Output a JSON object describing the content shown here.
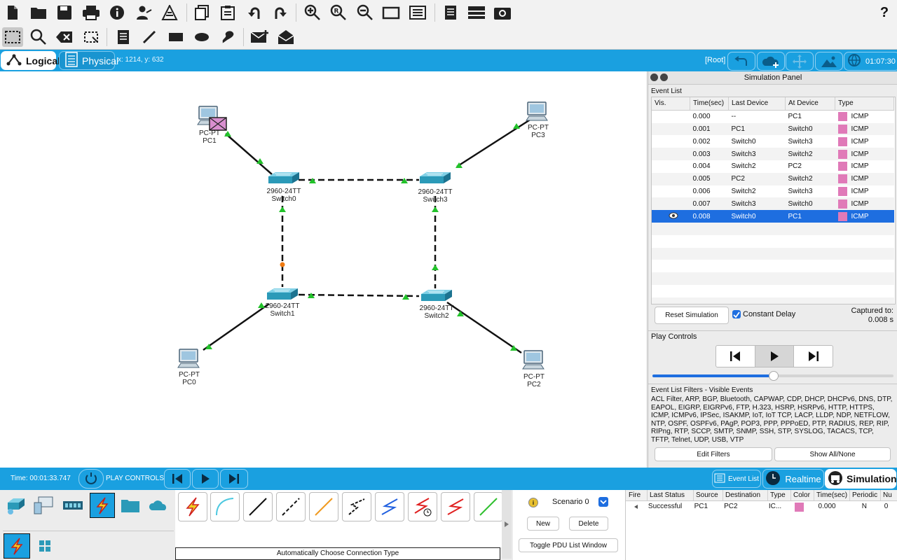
{
  "window": {
    "help": "?"
  },
  "tabs": {
    "logical": "Logical",
    "physical": "Physical",
    "coords": "x: 1214, y: 632"
  },
  "right_controls": {
    "root": "[Root]",
    "clock": "01:07:30"
  },
  "devices": [
    {
      "id": "pc1",
      "type": "PC-PT",
      "name": "PC1"
    },
    {
      "id": "pc3",
      "type": "PC-PT",
      "name": "PC3"
    },
    {
      "id": "pc0",
      "type": "PC-PT",
      "name": "PC0"
    },
    {
      "id": "pc2",
      "type": "PC-PT",
      "name": "PC2"
    },
    {
      "id": "sw0",
      "type": "2960-24TT",
      "name": "Switch0"
    },
    {
      "id": "sw3",
      "type": "2960-24TT",
      "name": "Switch3"
    },
    {
      "id": "sw1",
      "type": "2960-24TT",
      "name": "Switch1"
    },
    {
      "id": "sw2",
      "type": "2960-24TT",
      "name": "Switch2"
    }
  ],
  "sim": {
    "title": "Simulation Panel",
    "event_list_label": "Event List",
    "headers": [
      "Vis.",
      "Time(sec)",
      "Last Device",
      "At Device",
      "Type"
    ],
    "events": [
      {
        "time": "0.000",
        "last": "--",
        "at": "PC1",
        "type": "ICMP"
      },
      {
        "time": "0.001",
        "last": "PC1",
        "at": "Switch0",
        "type": "ICMP"
      },
      {
        "time": "0.002",
        "last": "Switch0",
        "at": "Switch3",
        "type": "ICMP"
      },
      {
        "time": "0.003",
        "last": "Switch3",
        "at": "Switch2",
        "type": "ICMP"
      },
      {
        "time": "0.004",
        "last": "Switch2",
        "at": "PC2",
        "type": "ICMP"
      },
      {
        "time": "0.005",
        "last": "PC2",
        "at": "Switch2",
        "type": "ICMP"
      },
      {
        "time": "0.006",
        "last": "Switch2",
        "at": "Switch3",
        "type": "ICMP"
      },
      {
        "time": "0.007",
        "last": "Switch3",
        "at": "Switch0",
        "type": "ICMP"
      },
      {
        "time": "0.008",
        "last": "Switch0",
        "at": "PC1",
        "type": "ICMP"
      }
    ],
    "event_color": "#e07ab8",
    "reset_label": "Reset Simulation",
    "constant_delay": "Constant Delay",
    "captured_label": "Captured to:",
    "captured_value": "0.008 s",
    "play_controls": "Play Controls",
    "progress": 0.5,
    "filters_title": "Event List Filters - Visible Events",
    "filters_text": "ACL Filter, ARP, BGP, Bluetooth, CAPWAP, CDP, DHCP, DHCPv6, DNS, DTP, EAPOL, EIGRP, EIGRPv6, FTP, H.323, HSRP, HSRPv6, HTTP, HTTPS, ICMP, ICMPv6, IPSec, ISAKMP, IoT, IoT TCP, LACP, LLDP, NDP, NETFLOW, NTP, OSPF, OSPFv6, PAgP, POP3, PPP, PPPoED, PTP, RADIUS, REP, RIP, RIPng, RTP, SCCP, SMTP, SNMP, SSH, STP, SYSLOG, TACACS, TCP, TFTP, Telnet, UDP, USB, VTP",
    "edit_filters": "Edit Filters",
    "show_all": "Show All/None"
  },
  "bottom_bar": {
    "time": "Time: 00:01:33.747",
    "play_controls": "PLAY CONTROLS",
    "event_list": "Event List",
    "realtime": "Realtime",
    "simulation": "Simulation"
  },
  "device_panel": {
    "connection_label": "Automatically Choose Connection Type"
  },
  "scenario": {
    "name": "Scenario 0",
    "new": "New",
    "delete": "Delete",
    "toggle": "Toggle PDU List Window"
  },
  "pdu": {
    "headers": [
      "Fire",
      "Last Status",
      "Source",
      "Destination",
      "Type",
      "Color",
      "Time(sec)",
      "Periodic",
      "Nu"
    ],
    "row": {
      "status": "Successful",
      "source": "PC1",
      "dest": "PC2",
      "type": "IC...",
      "time": "0.000",
      "periodic": "N",
      "num": "0"
    },
    "color": "#e07ab8"
  },
  "colors": {
    "accent": "#1aa0e0",
    "selected_row": "#1e6ee0",
    "link_up": "#22c22a",
    "switch": "#2b9ab8"
  }
}
